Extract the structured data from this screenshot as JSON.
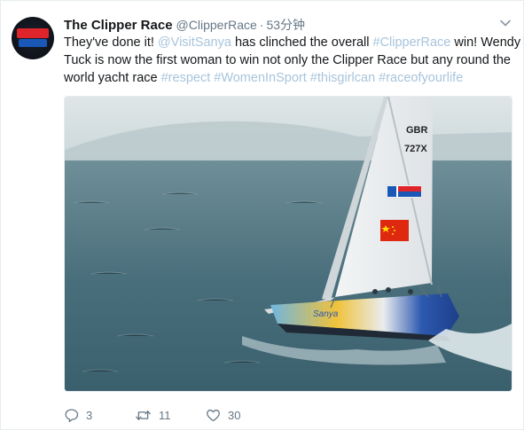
{
  "tweet": {
    "author": {
      "display_name": "The Clipper Race",
      "handle": "@ClipperRace",
      "separator": "·",
      "time": "53分钟",
      "avatar_text_top": "CLIPPER",
      "avatar_text_bottom": "round the world"
    },
    "text_lines": [
      [
        {
          "text": "They've done it! ",
          "link": false
        },
        {
          "text": "@VisitSanya",
          "link": true
        },
        {
          "text": " has clinched the overall ",
          "link": false
        },
        {
          "text": "#ClipperRace",
          "link": true
        },
        {
          "text": " win! Wendy",
          "link": false
        }
      ],
      [
        {
          "text": "Tuck is now the first woman to win not only the Clipper Race but any round the",
          "link": false
        }
      ],
      [
        {
          "text": "world yacht race ",
          "link": false
        },
        {
          "text": "#respect #WomenInSport #thisgirlcan #raceofyourlife",
          "link": true
        }
      ]
    ],
    "media": {
      "sail_number_country": "GBR",
      "sail_number": "727X",
      "sail_badge": "1718 CLIPPER",
      "hull_text": "Sanya"
    },
    "actions": {
      "reply_count": "3",
      "retweet_count": "11",
      "like_count": "30"
    },
    "colors": {
      "link": "#a7c4dc",
      "meta": "#657786",
      "text": "#14171a"
    }
  }
}
